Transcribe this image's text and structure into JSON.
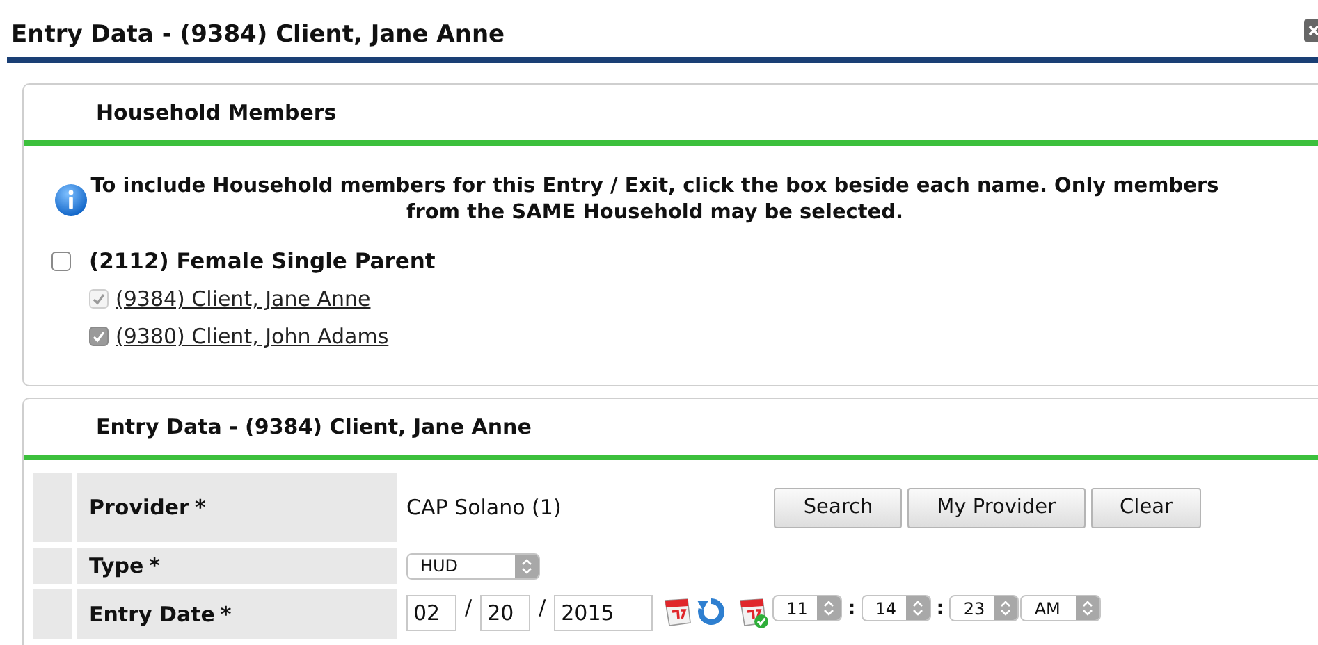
{
  "window": {
    "title": "Entry Data - (9384) Client, Jane Anne"
  },
  "household_panel": {
    "title": "Household Members",
    "info": "To include Household members for this Entry / Exit, click the box beside each name. Only members from the SAME Household may be selected.",
    "group": {
      "label": "(2112) Female Single Parent",
      "checked": false
    },
    "members": [
      {
        "label": "(9384) Client, Jane Anne",
        "checked": true,
        "disabled": true
      },
      {
        "label": "(9380) Client, John Adams",
        "checked": true,
        "disabled": false
      }
    ]
  },
  "entry_panel": {
    "title": "Entry Data - (9384) Client, Jane Anne",
    "fields": [
      {
        "kind": "provider",
        "label": "Provider",
        "required_mark": "*",
        "value": "CAP Solano (1)",
        "buttons": [
          "Search",
          "My Provider",
          "Clear"
        ]
      },
      {
        "kind": "select",
        "label": "Type",
        "required_mark": "*",
        "value": "HUD"
      },
      {
        "kind": "datetime",
        "label": "Entry Date",
        "required_mark": "*",
        "date": [
          "02",
          "20",
          "2015"
        ],
        "date_separator": "/",
        "time": [
          "11",
          "14",
          "23"
        ],
        "time_separator": ":",
        "ampm": "AM"
      }
    ]
  }
}
